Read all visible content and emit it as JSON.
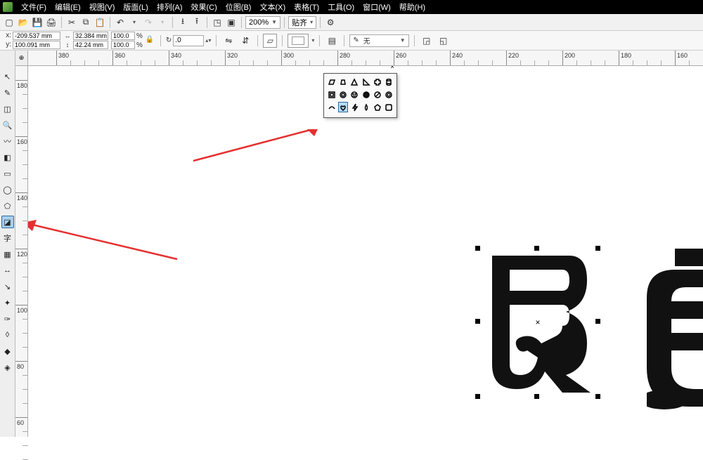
{
  "menu": {
    "items": [
      "文件(F)",
      "编辑(E)",
      "视图(V)",
      "版面(L)",
      "排列(A)",
      "效果(C)",
      "位图(B)",
      "文本(X)",
      "表格(T)",
      "工具(O)",
      "窗口(W)",
      "帮助(H)"
    ]
  },
  "toolbar": {
    "zoom": "200%",
    "snap_label": "贴齐"
  },
  "propbar": {
    "x_label": "x:",
    "y_label": "y:",
    "x_val": "-209.537 mm",
    "y_val": "100.091 mm",
    "w_val": "32.384 mm",
    "h_val": "42.24 mm",
    "sx_val": "100.0",
    "sy_val": "100.0",
    "pct": "%",
    "rot_label": "↻",
    "rot_val": ".0",
    "outline_icon": "ᴏ",
    "outline_label": "无"
  },
  "hruler": {
    "labels": [
      "380",
      "360",
      "340",
      "320",
      "300",
      "280",
      "260",
      "240",
      "220",
      "200",
      "180",
      "160"
    ]
  },
  "vruler": {
    "labels": [
      "180",
      "160",
      "140",
      "120",
      "100",
      "80",
      "60"
    ]
  },
  "left_tools": {
    "text_label": "字"
  },
  "shapes_panel": {
    "close": "×"
  }
}
